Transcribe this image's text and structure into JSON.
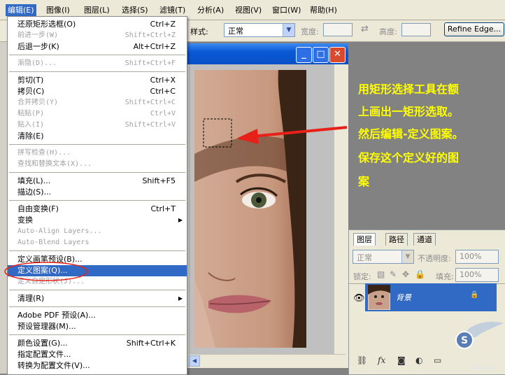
{
  "menubar": {
    "items": [
      "编辑(E)",
      "图像(I)",
      "图层(L)",
      "选择(S)",
      "滤镜(T)",
      "分析(A)",
      "视图(V)",
      "窗口(W)",
      "帮助(H)"
    ],
    "active_index": 0
  },
  "options_bar": {
    "style_label": "样式:",
    "style_value": "正常",
    "width_label": "宽度:",
    "height_label": "高度:",
    "refine_edge": "Refine Edge..."
  },
  "menu": {
    "items": [
      {
        "label": "还原矩形选框(O)",
        "shortcut": "Ctrl+Z",
        "enabled": true
      },
      {
        "label": "前进一步(W)",
        "shortcut": "Shift+Ctrl+Z",
        "enabled": false
      },
      {
        "label": "后退一步(K)",
        "shortcut": "Alt+Ctrl+Z",
        "enabled": true
      },
      {
        "sep": true
      },
      {
        "label": "渐隐(D)...",
        "shortcut": "Shift+Ctrl+F",
        "enabled": false
      },
      {
        "sep": true
      },
      {
        "label": "剪切(T)",
        "shortcut": "Ctrl+X",
        "enabled": true
      },
      {
        "label": "拷贝(C)",
        "shortcut": "Ctrl+C",
        "enabled": true
      },
      {
        "label": "合并拷贝(Y)",
        "shortcut": "Shift+Ctrl+C",
        "enabled": false
      },
      {
        "label": "粘贴(P)",
        "shortcut": "Ctrl+V",
        "enabled": false
      },
      {
        "label": "贴入(I)",
        "shortcut": "Shift+Ctrl+V",
        "enabled": false
      },
      {
        "label": "清除(E)",
        "shortcut": "",
        "enabled": true
      },
      {
        "sep": true
      },
      {
        "label": "拼写检查(H)...",
        "shortcut": "",
        "enabled": false
      },
      {
        "label": "查找和替换文本(X)...",
        "shortcut": "",
        "enabled": false
      },
      {
        "sep": true
      },
      {
        "label": "填充(L)...",
        "shortcut": "Shift+F5",
        "enabled": true
      },
      {
        "label": "描边(S)...",
        "shortcut": "",
        "enabled": true
      },
      {
        "sep": true
      },
      {
        "label": "自由变换(F)",
        "shortcut": "Ctrl+T",
        "enabled": true
      },
      {
        "label": "变换",
        "shortcut": "",
        "enabled": true,
        "submenu": true
      },
      {
        "label": "Auto-Align Layers...",
        "shortcut": "",
        "enabled": false
      },
      {
        "label": "Auto-Blend Layers",
        "shortcut": "",
        "enabled": false
      },
      {
        "sep": true
      },
      {
        "label": "定义画笔预设(B)...",
        "shortcut": "",
        "enabled": true
      },
      {
        "label": "定义图案(Q)...",
        "shortcut": "",
        "enabled": true,
        "selected": true
      },
      {
        "label": "定义自定形状(J)...",
        "shortcut": "",
        "enabled": false
      },
      {
        "sep": true
      },
      {
        "label": "清理(R)",
        "shortcut": "",
        "enabled": true,
        "submenu": true
      },
      {
        "sep": true
      },
      {
        "label": "Adobe PDF 预设(A)...",
        "shortcut": "",
        "enabled": true
      },
      {
        "label": "预设管理器(M)...",
        "shortcut": "",
        "enabled": true
      },
      {
        "sep": true
      },
      {
        "label": "颜色设置(G)...",
        "shortcut": "Shift+Ctrl+K",
        "enabled": true
      },
      {
        "label": "指定配置文件...",
        "shortcut": "",
        "enabled": true
      },
      {
        "label": "转换为配置文件(V)...",
        "shortcut": "",
        "enabled": true
      }
    ]
  },
  "annotation": {
    "lines": [
      "用矩形选择工具在额",
      "上画出一矩形选取。",
      "然后编辑-定义图案。",
      "保存这个定义好的图",
      "案"
    ]
  },
  "layers_panel": {
    "tabs": [
      "图层",
      "路径",
      "通道"
    ],
    "active_tab": 0,
    "blend_mode": "正常",
    "opacity_label": "不透明度:",
    "opacity_value": "100%",
    "lock_label": "锁定:",
    "fill_label": "填充:",
    "fill_value": "100%",
    "layer_name": "背景"
  },
  "watermark": {
    "text": "S",
    "sub": "yuu.com"
  },
  "colors": {
    "selection": "#316ac5",
    "annotation": "#ffff00",
    "arrow": "#e8201a",
    "xp_title": "#0a58d6"
  }
}
